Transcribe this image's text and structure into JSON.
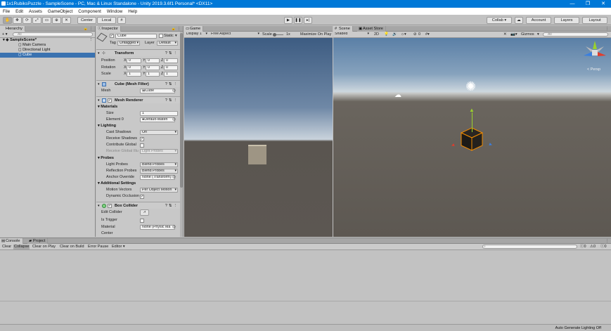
{
  "window": {
    "title": "1x1RubiksPuzzle - SampleScene - PC, Mac & Linux Standalone - Unity 2019.3.6f1 Personal* <DX11>",
    "min": "—",
    "max": "❐",
    "close": "✕"
  },
  "menu": [
    "File",
    "Edit",
    "Assets",
    "GameObject",
    "Component",
    "Window",
    "Help"
  ],
  "toolbar": {
    "center": "Center",
    "local": "Local",
    "collab": "Collab ▾",
    "account": "Account",
    "layers": "Layers",
    "layout": "Layout"
  },
  "hierarchy": {
    "tab": "Hierarchy",
    "create": "+ ▾",
    "search_placeholder": "All",
    "scene": "SampleScene*",
    "items": [
      "Main Camera",
      "Directional Light",
      "Cube"
    ]
  },
  "inspector": {
    "tab": "Inspector",
    "object_name": "Cube",
    "static_label": "Static",
    "tag_label": "Tag",
    "tag": "Untagged",
    "layer_label": "Layer",
    "layer": "Default",
    "transform": {
      "title": "Transform",
      "rows": [
        {
          "label": "Position",
          "x": "0",
          "y": "0",
          "z": "0"
        },
        {
          "label": "Rotation",
          "x": "0",
          "y": "0",
          "z": "0"
        },
        {
          "label": "Scale",
          "x": "1",
          "y": "1",
          "z": "1"
        }
      ]
    },
    "axis": {
      "x": "X",
      "y": "Y",
      "z": "Z"
    },
    "mesh_filter": {
      "title": "Cube (Mesh Filter)",
      "mesh_label": "Mesh",
      "mesh": "Cube"
    },
    "mesh_renderer": {
      "title": "Mesh Renderer",
      "materials": "Materials",
      "size_label": "Size",
      "size": "1",
      "element0_label": "Element 0",
      "element0": "Default-Materi",
      "lighting": "Lighting",
      "cast_shadows_label": "Cast Shadows",
      "cast_shadows": "On",
      "receive_shadows_label": "Receive Shadows",
      "contribute_gi_label": "Contribute Global",
      "receive_gi_label": "Receive Global Illu",
      "receive_gi": "Light Probes",
      "probes": "Probes",
      "light_probes_label": "Light Probes",
      "light_probes": "Blend Probes",
      "reflection_probes_label": "Reflection Probes",
      "reflection_probes": "Blend Probes",
      "anchor_label": "Anchor Override",
      "anchor": "None (Transform)",
      "additional": "Additional Settings",
      "motion_vectors_label": "Motion Vectors",
      "motion_vectors": "Per Object Motion",
      "dynamic_occlusion_label": "Dynamic Occlusion"
    },
    "box_collider": {
      "title": "Box Collider",
      "edit_label": "Edit Collider",
      "trigger_label": "Is Trigger",
      "material_label": "Material",
      "material": "None (Physic Ma",
      "center_label": "Center"
    }
  },
  "game": {
    "tab": "Game",
    "display": "Display 1",
    "aspect": "Free Aspect",
    "scale_label": "Scale",
    "scale": "1x",
    "maximize": "Maximize On Play"
  },
  "scene": {
    "tab": "Scene",
    "asset_store_tab": "Asset Store",
    "shading": "Shaded",
    "mode2d": "2D",
    "gizmos": "Gizmos",
    "search_placeholder": "All",
    "persp": "< Persp",
    "count": "0"
  },
  "console": {
    "tab": "Console",
    "project_tab": "Project",
    "buttons": [
      "Clear",
      "Collapse",
      "Clear on Play",
      "Clear on Build",
      "Error Pause",
      "Editor ▾"
    ],
    "err_count": "0",
    "warn_count": "0",
    "log_count": "0"
  },
  "status": {
    "text": "Auto Generate Lighting Off"
  }
}
